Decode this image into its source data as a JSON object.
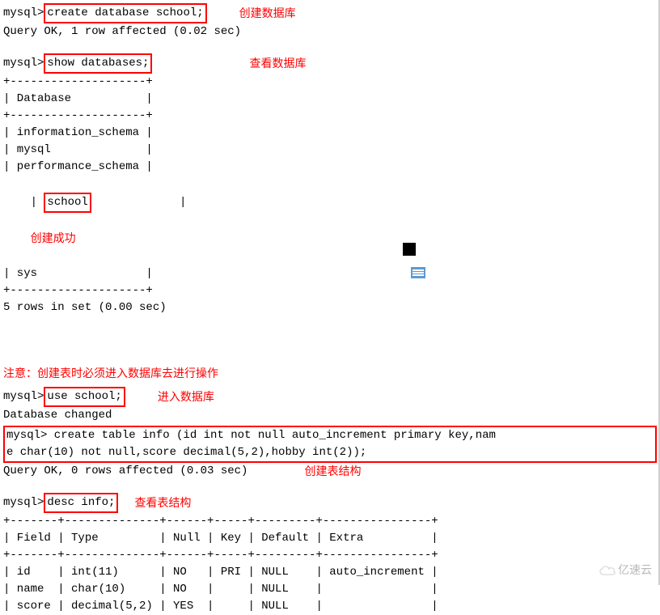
{
  "section1": {
    "prompt": "mysql> ",
    "command": "create database school;",
    "annotation": "创建数据库",
    "result": "Query OK, 1 row affected (0.02 sec)"
  },
  "section2": {
    "prompt": "mysql> ",
    "command": "show databases;",
    "annotation": "查看数据库",
    "border_top": "+--------------------+",
    "header": "| Database           |",
    "border_mid": "+--------------------+",
    "row1": "| information_schema |",
    "row2": "| mysql              |",
    "row3": "| performance_schema |",
    "row4_prefix": "| ",
    "row4_boxed": "school",
    "row4_suffix": "             |",
    "row4_annotation": "创建成功",
    "row5": "| sys                |",
    "border_bot": "+--------------------+",
    "result": "5 rows in set (0.00 sec)"
  },
  "note_line": "注意：创建表时必须进入数据库去进行操作",
  "section3": {
    "prompt": "mysql> ",
    "command": "use school;",
    "annotation": "进入数据库",
    "result": "Database changed"
  },
  "section4": {
    "line1": "mysql> create table info (id int not null auto_increment primary key,nam",
    "line2": "e char(10) not null,score decimal(5,2),hobby int(2));",
    "result": "Query OK, 0 rows affected (0.03 sec)",
    "annotation": "创建表结构"
  },
  "section5": {
    "prompt": "mysql> ",
    "command": "desc info;",
    "annotation": "查看表结构",
    "border_top": "+-------+--------------+------+-----+---------+----------------+",
    "header": "| Field | Type         | Null | Key | Default | Extra          |",
    "border_mid": "+-------+--------------+------+-----+---------+----------------+",
    "row1": "| id    | int(11)      | NO   | PRI | NULL    | auto_increment |",
    "row2": "| name  | char(10)     | NO   |     | NULL    |                |",
    "row3": "| score | decimal(5,2) | YES  |     | NULL    |                |"
  },
  "watermark_text": "亿速云"
}
